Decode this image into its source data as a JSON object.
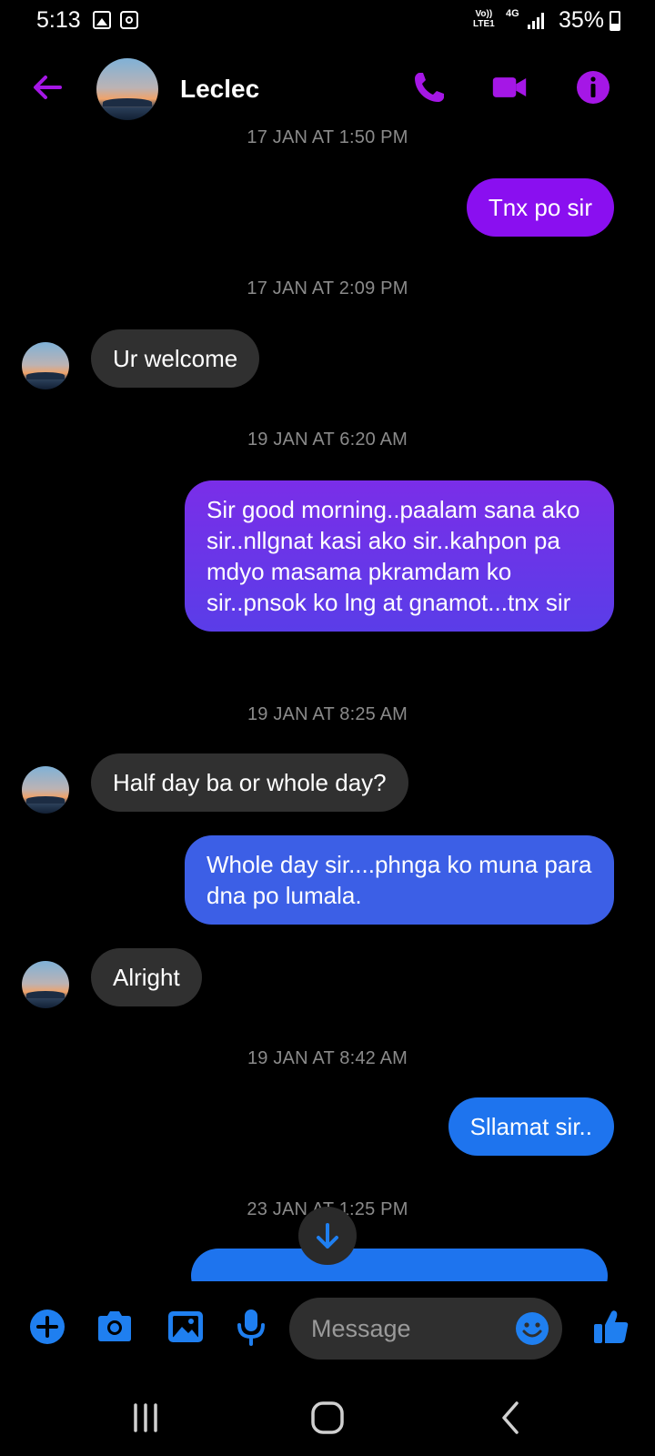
{
  "status_bar": {
    "time": "5:13",
    "volte_top": "Vo))",
    "volte_bottom": "LTE1",
    "network": "4G",
    "battery": "35%"
  },
  "header": {
    "contact_name": "Leclec"
  },
  "messages": [
    {
      "type": "timestamp",
      "text": "17 JAN AT 1:50 PM"
    },
    {
      "type": "out",
      "text": "Tnx po sir",
      "color": "#8a0ff0"
    },
    {
      "type": "timestamp",
      "text": "17 JAN AT 2:09 PM"
    },
    {
      "type": "in",
      "text": "Ur welcome"
    },
    {
      "type": "timestamp",
      "text": "19 JAN AT 6:20 AM"
    },
    {
      "type": "out",
      "text": "Sir good morning..paalam sana ako sir..nllgnat kasi ako sir..kahpon pa mdyo masama pkramdam ko sir..pnsok ko lng at gnamot...tnx sir",
      "color": "#6a35ea"
    },
    {
      "type": "timestamp",
      "text": "19 JAN AT 8:25 AM"
    },
    {
      "type": "in",
      "text": "Half day ba or whole day?"
    },
    {
      "type": "out",
      "text": "Whole day sir....phnga ko muna para dna po lumala.",
      "color": "#3c5fe6"
    },
    {
      "type": "in",
      "text": "Alright"
    },
    {
      "type": "timestamp",
      "text": "19 JAN AT 8:42 AM"
    },
    {
      "type": "out",
      "text": "Sllamat sir..",
      "color": "#1e74ee"
    },
    {
      "type": "timestamp",
      "text": "23 JAN AT 1:25 PM"
    }
  ],
  "composer": {
    "placeholder": "Message"
  },
  "colors": {
    "accent_purple": "#a517e6",
    "accent_blue": "#1f7ff0",
    "incoming_bubble": "#303030",
    "background": "#000000"
  },
  "icons": {
    "back": "arrow-left-icon",
    "call": "phone-icon",
    "video": "video-camera-icon",
    "info": "info-icon",
    "add": "plus-circle-icon",
    "camera": "camera-icon",
    "gallery": "image-icon",
    "mic": "microphone-icon",
    "emoji": "smiley-icon",
    "like": "thumbs-up-icon",
    "scroll": "arrow-down-icon"
  }
}
